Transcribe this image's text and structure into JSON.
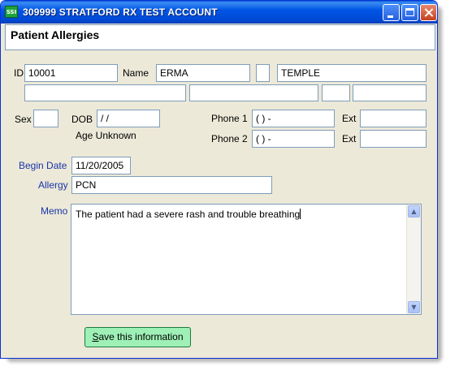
{
  "window": {
    "icon_text": "SSI",
    "title": "309999 STRATFORD RX TEST ACCOUNT"
  },
  "form": {
    "heading": "Patient Allergies",
    "labels": {
      "id": "ID",
      "name": "Name",
      "sex": "Sex",
      "dob": "DOB",
      "age": "Age Unknown",
      "phone1": "Phone 1",
      "phone2": "Phone 2",
      "ext1": "Ext",
      "ext2": "Ext",
      "begin_date": "Begin Date",
      "allergy": "Allergy",
      "memo": "Memo"
    },
    "values": {
      "id": "10001",
      "first_name": "ERMA",
      "middle_initial": "",
      "last_name": "TEMPLE",
      "address1": "",
      "address2": "",
      "city": "",
      "state": "",
      "zip": "",
      "sex": "",
      "dob": " / /",
      "phone1": "( )   -",
      "phone2": "( )   -",
      "ext1": "",
      "ext2": "",
      "begin_date": "11/20/2005",
      "allergy": "PCN",
      "memo": "The patient had a severe rash and trouble breathing"
    }
  },
  "actions": {
    "save_hotkey": "S",
    "save_rest": "ave this information"
  },
  "icons": [
    "app-icon",
    "minimize-icon",
    "maximize-icon",
    "close-icon",
    "scroll-up-icon",
    "scroll-down-icon"
  ]
}
